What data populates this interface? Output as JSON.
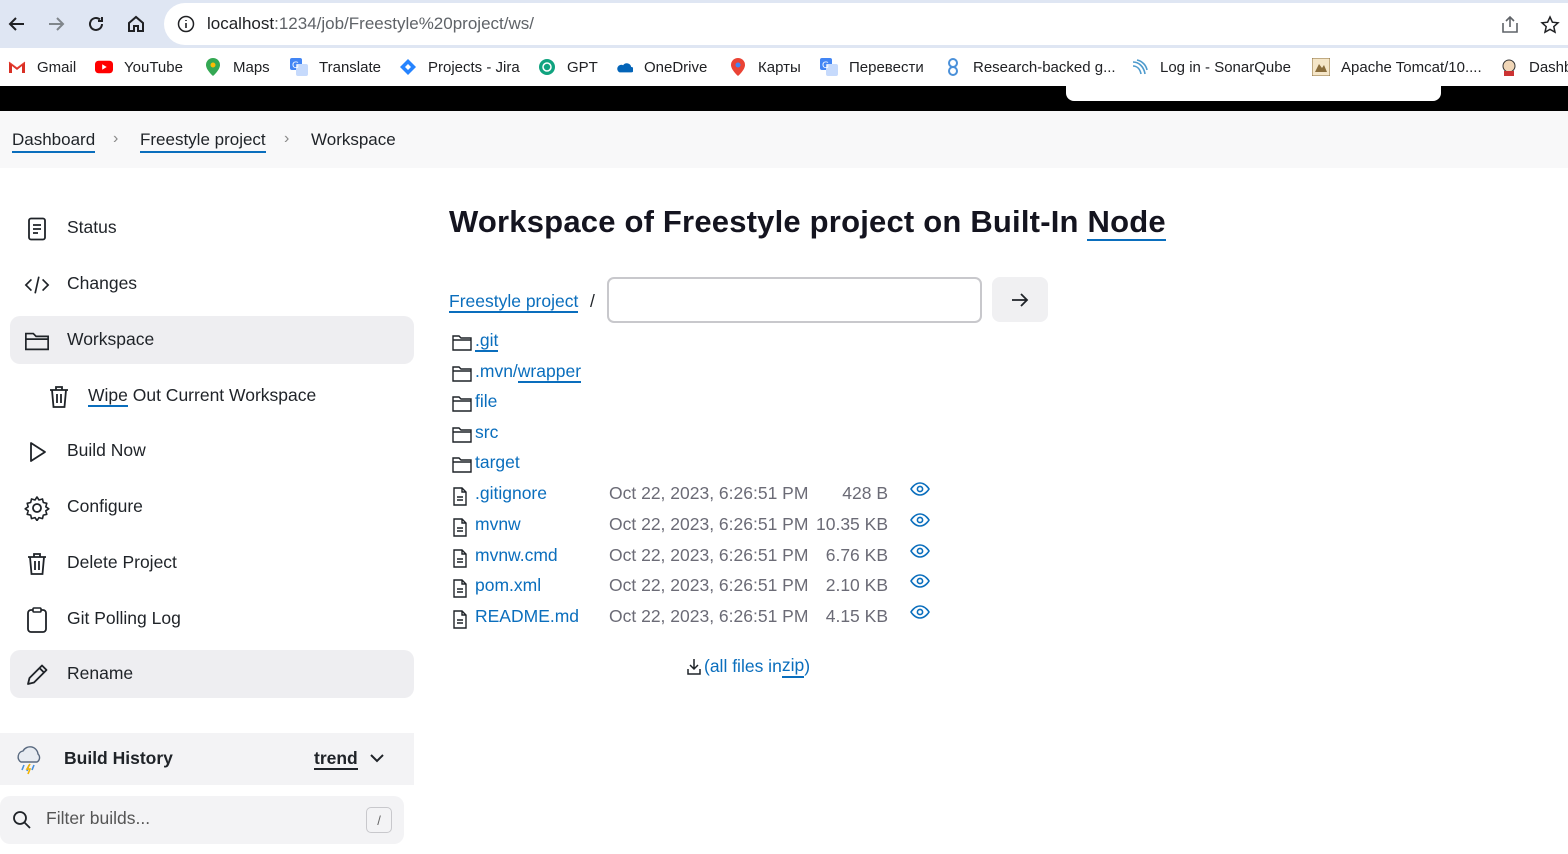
{
  "browser": {
    "url_host": "localhost",
    "url_path": ":1234/job/Freestyle%20project/ws/",
    "bookmarks": [
      {
        "label": "Gmail",
        "icon": "gmail-icon"
      },
      {
        "label": "YouTube",
        "icon": "youtube-icon"
      },
      {
        "label": "Maps",
        "icon": "maps-icon"
      },
      {
        "label": "Translate",
        "icon": "translate-icon"
      },
      {
        "label": "Projects - Jira",
        "icon": "jira-icon"
      },
      {
        "label": "GPT",
        "icon": "gpt-icon"
      },
      {
        "label": "OneDrive",
        "icon": "onedrive-icon"
      },
      {
        "label": "Карты",
        "icon": "maps-icon"
      },
      {
        "label": "Перевести",
        "icon": "translate-icon"
      },
      {
        "label": "Research-backed g...",
        "icon": "research-icon"
      },
      {
        "label": "Log in - SonarQube",
        "icon": "sonarqube-icon"
      },
      {
        "label": "Apache Tomcat/10....",
        "icon": "tomcat-icon"
      },
      {
        "label": "Dashb",
        "icon": "jenkins-icon"
      }
    ]
  },
  "breadcrumb": {
    "items": [
      "Dashboard",
      "Freestyle project",
      "Workspace"
    ]
  },
  "sidebar": {
    "items": [
      {
        "label": "Status",
        "icon": "status-icon"
      },
      {
        "label": "Changes",
        "icon": "code-icon"
      },
      {
        "label": "Workspace",
        "icon": "folder-icon"
      },
      {
        "label_underlined": "Wipe",
        "label_rest": " Out Current Workspace",
        "icon": "trash-icon"
      },
      {
        "label": "Build Now",
        "icon": "play-icon"
      },
      {
        "label": "Configure",
        "icon": "gear-icon"
      },
      {
        "label": "Delete Project",
        "icon": "trash-icon"
      },
      {
        "label": "Git Polling Log",
        "icon": "clipboard-icon"
      },
      {
        "label": "Rename",
        "icon": "pencil-icon"
      }
    ],
    "build_history": {
      "title": "Build History",
      "trend": "trend",
      "filter_placeholder": "Filter builds...",
      "filter_shortcut": "/"
    }
  },
  "main": {
    "title_prefix": "Workspace of Freestyle project on Built-In ",
    "title_node": "Node",
    "path_root": "Freestyle project",
    "path_sep": "/",
    "path_input_value": "",
    "folders": [
      {
        "name": ".git"
      },
      {
        "name_prefix": ".mvn/",
        "name_sub": "wrapper"
      },
      {
        "name": "file"
      },
      {
        "name": "src"
      },
      {
        "name": "target"
      }
    ],
    "files": [
      {
        "name": ".gitignore",
        "date": "Oct 22, 2023, 6:26:51 PM",
        "size": "428 B"
      },
      {
        "name": "mvnw",
        "date": "Oct 22, 2023, 6:26:51 PM",
        "size": "10.35 KB"
      },
      {
        "name": "mvnw.cmd",
        "date": "Oct 22, 2023, 6:26:51 PM",
        "size": "6.76 KB"
      },
      {
        "name": "pom.xml",
        "date": "Oct 22, 2023, 6:26:51 PM",
        "size": "2.10 KB"
      },
      {
        "name": "README.md",
        "date": "Oct 22, 2023, 6:26:51 PM",
        "size": "4.15 KB"
      }
    ],
    "zip_open": "(all files in ",
    "zip_link": "zip",
    "zip_close": ")"
  },
  "colors": {
    "link": "#0a6ebd",
    "browser_chrome": "#dfe6f3",
    "header": "#000000",
    "active_item": "#eeeef1"
  }
}
